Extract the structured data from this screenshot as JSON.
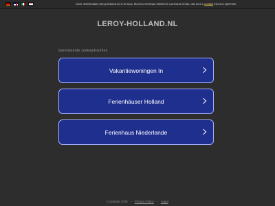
{
  "topbar": {
    "flags": [
      {
        "icon": "de-flag-icon"
      },
      {
        "icon": "gb-flag-icon"
      },
      {
        "icon": "it-flag-icon"
      },
      {
        "icon": "nl-flag-icon"
      }
    ],
    "notice_prefix": "Deze domeinnaam (leroy-holland.nl) is te koop. Mocht u interesse hebben in overname eman, dan kunt u",
    "notice_link": "contact",
    "notice_suffix": "met ons opnemen."
  },
  "header": {
    "site_title": "LEROY-HOLLAND.NL"
  },
  "main": {
    "section_label": "Gerelateerde zoekopdrachten",
    "links": [
      {
        "label": "Vakantiewoningen In"
      },
      {
        "label": "Ferienhäuser Holland"
      },
      {
        "label": "Ferienhaus Niederlande"
      }
    ]
  },
  "footer": {
    "copyright": "Copyright 2025",
    "privacy": "Privacy Policy",
    "legal": "Legal"
  },
  "colors": {
    "background": "#2d2d2d",
    "button_bg": "#1f2f8e",
    "button_border": "#a7b0ff",
    "link_accent": "#f2d45c"
  }
}
